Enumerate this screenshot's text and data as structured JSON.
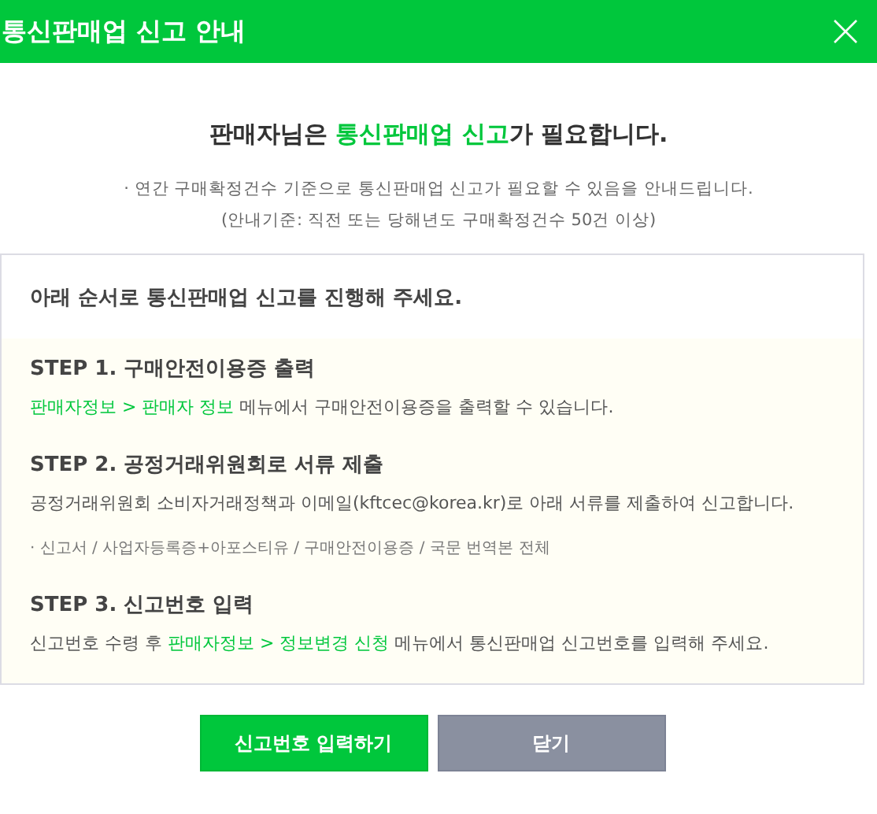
{
  "window": {
    "title": "통신판매업 신고 안내"
  },
  "headline": [
    {
      "text": "판매자님은 ",
      "highlight": false
    },
    {
      "text": "통신판매업 신고",
      "highlight": true
    },
    {
      "text": "가 필요합니다.",
      "highlight": false
    }
  ],
  "notes": [
    "· 연간 구매확정건수 기준으로 통신판매업 신고가 필요할 수 있음을 안내드립니다.",
    "(안내기준: 직전 또는 당해년도 구매확정건수 50건 이상)"
  ],
  "guide": {
    "title": "아래 순서로 통신판매업 신고를 진행해 주세요.",
    "steps": [
      {
        "title": "STEP 1. 구매안전이용증 출력",
        "lines": [
          {
            "kind": "text",
            "segments": [
              {
                "text": "판매자정보 > 판매자 정보",
                "highlight": true
              },
              {
                "text": " 메뉴에서 구매안전이용증을 출력할 수 있습니다.",
                "highlight": false
              }
            ]
          }
        ]
      },
      {
        "title": "STEP 2. 공정거래위원회로 서류 제출",
        "lines": [
          {
            "kind": "text",
            "segments": [
              {
                "text": "공정거래위원회 소비자거래정책과 이메일(kftcec@korea.kr)로 아래 서류를 제출하여 신고합니다.",
                "highlight": false
              }
            ]
          },
          {
            "kind": "note",
            "segments": [
              {
                "text": "·  신고서 / 사업자등록증+아포스티유 / 구매안전이용증 / 국문 번역본 전체",
                "highlight": false
              }
            ]
          }
        ]
      },
      {
        "title": "STEP 3. 신고번호 입력",
        "lines": [
          {
            "kind": "text",
            "segments": [
              {
                "text": "신고번호 수령 후 ",
                "highlight": false
              },
              {
                "text": "판매자정보 > 정보변경 신청",
                "highlight": true
              },
              {
                "text": " 메뉴에서 통신판매업 신고번호를 입력해 주세요.",
                "highlight": false
              }
            ]
          }
        ]
      }
    ]
  },
  "buttons": [
    {
      "label": "신고번호 입력하기",
      "kind": "primary"
    },
    {
      "label": "닫기",
      "kind": "secondary"
    }
  ]
}
